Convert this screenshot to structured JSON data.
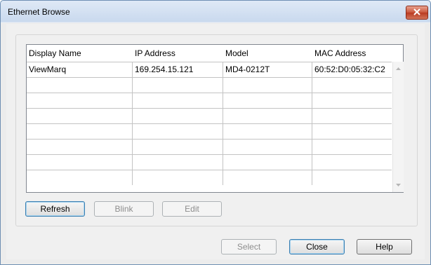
{
  "window": {
    "title": "Ethernet Browse"
  },
  "table": {
    "columns": [
      "Display Name",
      "IP Address",
      "Model",
      "MAC Address"
    ],
    "rows": [
      [
        "ViewMarq",
        "169.254.15.121",
        "MD4-0212T",
        "60:52:D0:05:32:C2"
      ],
      [
        "",
        "",
        "",
        ""
      ],
      [
        "",
        "",
        "",
        ""
      ],
      [
        "",
        "",
        "",
        ""
      ],
      [
        "",
        "",
        "",
        ""
      ],
      [
        "",
        "",
        "",
        ""
      ],
      [
        "",
        "",
        "",
        ""
      ],
      [
        "",
        "",
        "",
        ""
      ]
    ]
  },
  "buttons": {
    "refresh": "Refresh",
    "blink": "Blink",
    "edit": "Edit",
    "select": "Select",
    "close": "Close",
    "help": "Help"
  }
}
